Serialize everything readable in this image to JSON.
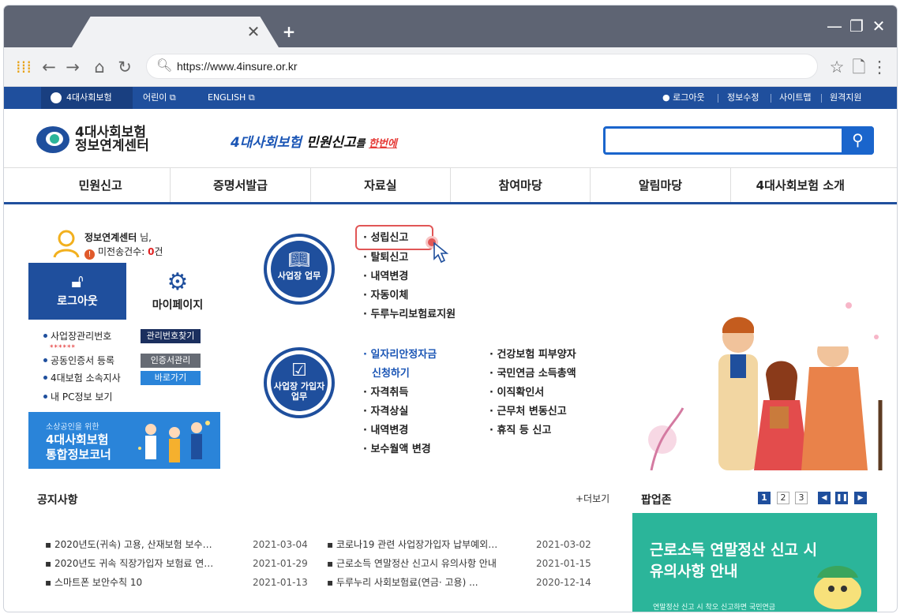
{
  "browser": {
    "tab_close": "✕",
    "tab_new": "+",
    "window_minimize": "—",
    "window_restore": "❐",
    "window_close": "✕",
    "url": "https://www.4insure.or.kr"
  },
  "util": {
    "home_label": "4대사회보험",
    "links": [
      "어린이",
      "ENGLISH"
    ],
    "right": [
      "로그아웃",
      "정보수정",
      "사이트맵",
      "원격지원"
    ]
  },
  "brand": {
    "logo_line1": "4대사회보험",
    "logo_line2": "정보연계센터",
    "slogan_prefix": "4대사회보험 ",
    "slogan_main": "민원신고",
    "slogan_suffix": "를 ",
    "slogan_small": "한번에"
  },
  "gnb": [
    "민원신고",
    "증명서발급",
    "자료실",
    "참여마당",
    "알림마당",
    "4대사회보험 소개"
  ],
  "user": {
    "name": "정보연계센터",
    "honorific": " 님,",
    "unsent_label": "미전송건수: ",
    "unsent_count": "0",
    "unsent_unit": "건",
    "logout": "로그아웃",
    "mypage": "마이페이지"
  },
  "quick": {
    "rows": [
      "사업장관리번호",
      "공동인증서 등록",
      "4대보험 소속지사",
      "내 PC정보 보기"
    ],
    "buttons": [
      "관리번호찾기",
      "인증서관리",
      "바로가기"
    ],
    "masked": "******"
  },
  "left_banner": {
    "line1": "소상공인을 위한",
    "line2": "4대사회보험",
    "line3": "통합정보코너"
  },
  "business": {
    "label": "사업장 업무",
    "items": [
      "성립신고",
      "탈퇴신고",
      "내역변경",
      "자동이체",
      "두루누리보험료지원"
    ]
  },
  "subscriber": {
    "label_line1": "사업장 가입자",
    "label_line2": "업무",
    "col1_highlight_1": "일자리안정자금",
    "col1_highlight_2": "신청하기",
    "col1": [
      "자격취득",
      "자격상실",
      "내역변경",
      "보수월액 변경"
    ],
    "col2": [
      "건강보험 피부양자",
      "국민연금 소득총액",
      "이직확인서",
      "근무처 변동신고",
      "휴직 등 신고"
    ]
  },
  "notice": {
    "title": "공지사항",
    "more": "+더보기",
    "left": [
      {
        "title": "2020년도(귀속) 고용, 산재보험 보수…",
        "date": "2021-03-04"
      },
      {
        "title": "2020년도 귀속 직장가입자 보험료 연…",
        "date": "2021-01-29"
      },
      {
        "title": "스마트폰 보안수칙 10",
        "date": "2021-01-13"
      }
    ],
    "right": [
      {
        "title": "코로나19 관련 사업장가입자 납부예외…",
        "date": "2021-03-02"
      },
      {
        "title": "근로소득 연말정산 신고시 유의사항 안내",
        "date": "2021-01-15"
      },
      {
        "title": "두루누리 사회보험료(연금· 고용) ...",
        "date": "2020-12-14"
      }
    ]
  },
  "popup": {
    "title": "팝업존",
    "pages": [
      "1",
      "2",
      "3"
    ],
    "controls": [
      "◀",
      "❚❚",
      "▶"
    ],
    "headline_1": "근로소득 연말정산 신고 시",
    "headline_2": "유의사항 안내",
    "sub": "연말정산 신고 시 착오 신고하면 국민연금"
  },
  "colors": {
    "primary": "#1f4f9d",
    "accent_red": "#e15656",
    "popup_green": "#2bb59a"
  }
}
